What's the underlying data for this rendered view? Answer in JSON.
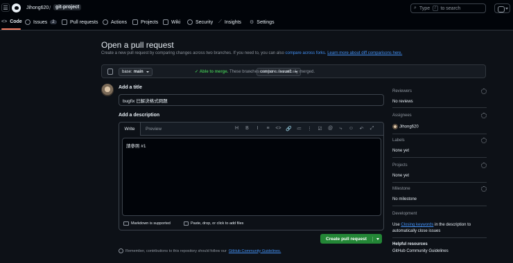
{
  "header": {
    "owner": "Jihong620",
    "separator": "/",
    "repo": "git-project",
    "search_prefix": "Type",
    "search_key": "/",
    "search_suffix": "to search"
  },
  "nav": {
    "code": "Code",
    "issues": "Issues",
    "issues_count": "2",
    "pulls": "Pull requests",
    "actions": "Actions",
    "projects": "Projects",
    "wiki": "Wiki",
    "security": "Security",
    "insights": "Insights",
    "settings": "Settings"
  },
  "page": {
    "title": "Open a pull request",
    "intro": "Create a new pull request by comparing changes across two branches. If you need to, you can also",
    "compare_forks_link": "compare across forks.",
    "learn_more_link": "Learn more about diff comparisons here."
  },
  "compare": {
    "base_label": "base:",
    "base_value": "main",
    "arrow": "←",
    "compare_label": "compare:",
    "compare_value": "issue1",
    "check": "✓",
    "able": "Able to merge.",
    "able_desc": "These branches can be automatically merged."
  },
  "form": {
    "title_label": "Add a title",
    "title_value": "bugfix 已解決格式問題",
    "desc_label": "Add a description",
    "write_tab": "Write",
    "preview_tab": "Preview",
    "body": "請參照 #1",
    "markdown_note": "Markdown is supported",
    "attach_note": "Paste, drop, or click to add files",
    "create_button": "Create pull request",
    "remember_prefix": "Remember, contributions to this repository should follow our",
    "remember_link": "GitHub Community Guidelines."
  },
  "toolbar": [
    "H",
    "B",
    "I",
    "≡",
    "<>",
    "🔗",
    "≔",
    "⋮",
    "☑",
    "@",
    "⤷",
    "☺",
    "↶",
    "⤢"
  ],
  "sidebar": {
    "reviewers": {
      "label": "Reviewers",
      "value": "No reviews"
    },
    "assignees": {
      "label": "Assignees",
      "value": "Jihong620"
    },
    "labels": {
      "label": "Labels",
      "value": "None yet"
    },
    "projects": {
      "label": "Projects",
      "value": "None yet"
    },
    "milestone": {
      "label": "Milestone",
      "value": "No milestone"
    },
    "development": {
      "label": "Development",
      "use": "Use",
      "closing_link": "Closing keywords",
      "rest": "in the description to automatically close issues"
    },
    "helpful": {
      "label": "Helpful resources",
      "link": "GitHub Community Guidelines"
    }
  },
  "colors": {
    "accent": "#238636",
    "link": "#4493f8",
    "success": "#3fb950",
    "tab_underline": "#f78166"
  }
}
